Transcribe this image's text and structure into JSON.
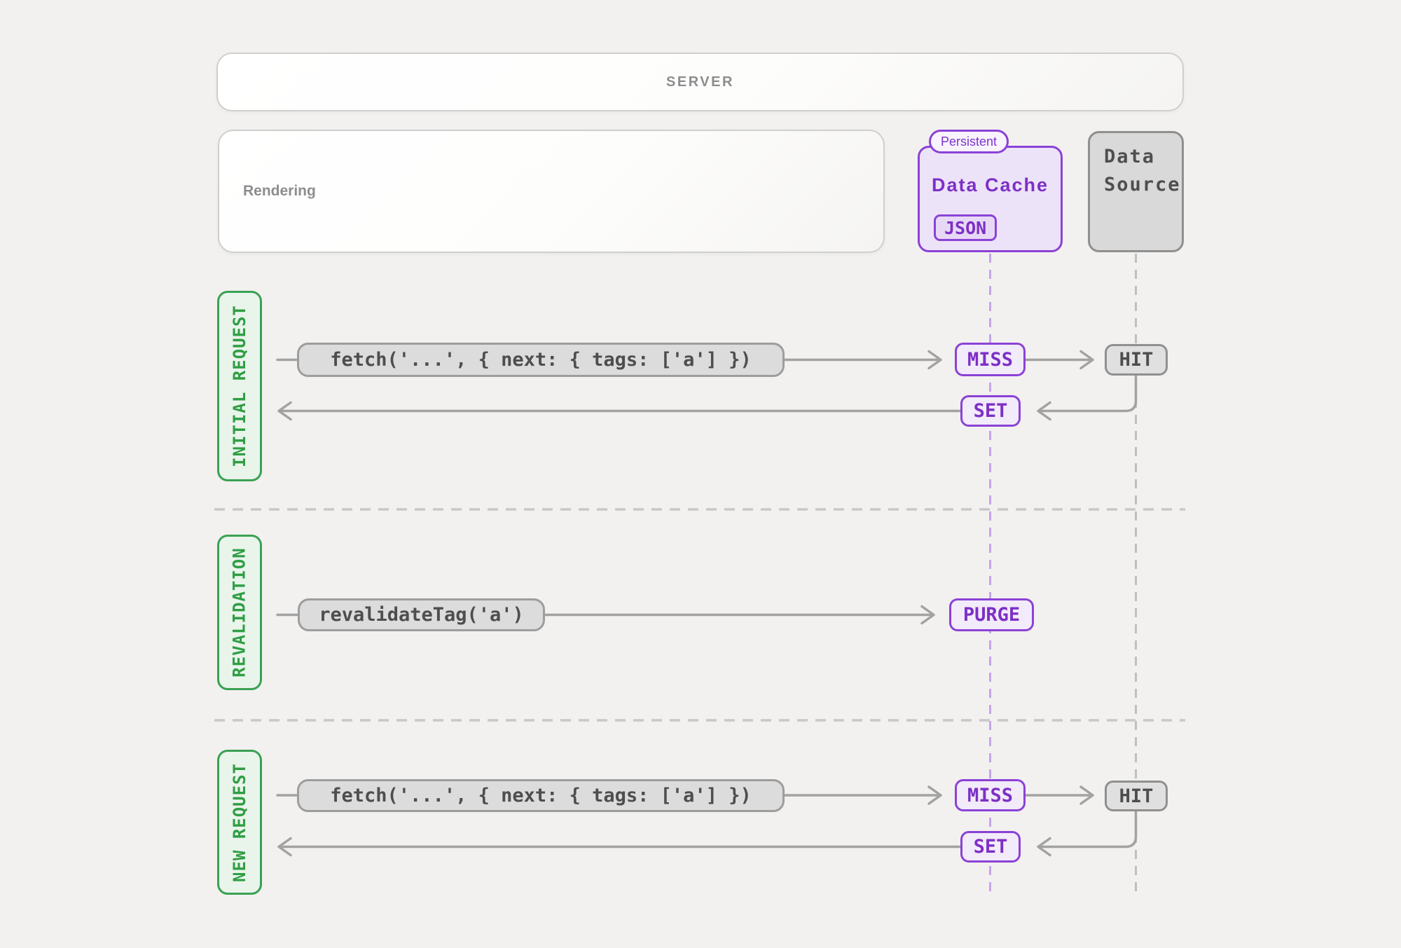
{
  "server": {
    "label": "SERVER"
  },
  "rendering": {
    "label": "Rendering"
  },
  "data_cache": {
    "tag": "Persistent",
    "title": "Data Cache",
    "badge": "JSON"
  },
  "data_source": {
    "line1": "Data",
    "line2": "Source"
  },
  "sections": {
    "initial_request": {
      "label": "INITIAL REQUEST",
      "fetch_call": "fetch('...', { next: { tags: ['a'] })",
      "cache_result": "MISS",
      "source_result": "HIT",
      "cache_write": "SET"
    },
    "revalidation": {
      "label": "REVALIDATION",
      "call": "revalidateTag('a')",
      "cache_action": "PURGE"
    },
    "new_request": {
      "label": "NEW REQUEST",
      "fetch_call": "fetch('...', { next: { tags: ['a'] })",
      "cache_result": "MISS",
      "source_result": "HIT",
      "cache_write": "SET"
    }
  },
  "colors": {
    "accent_purple": "#8b42d6",
    "accent_purple_text": "#7d2fc6",
    "accent_green": "#3aa152",
    "accent_green_text": "#2f9e44",
    "neutral_gray_border": "#9d9d9d",
    "arrow_gray": "#a2a2a2",
    "page_background": "#f2f1ef"
  }
}
